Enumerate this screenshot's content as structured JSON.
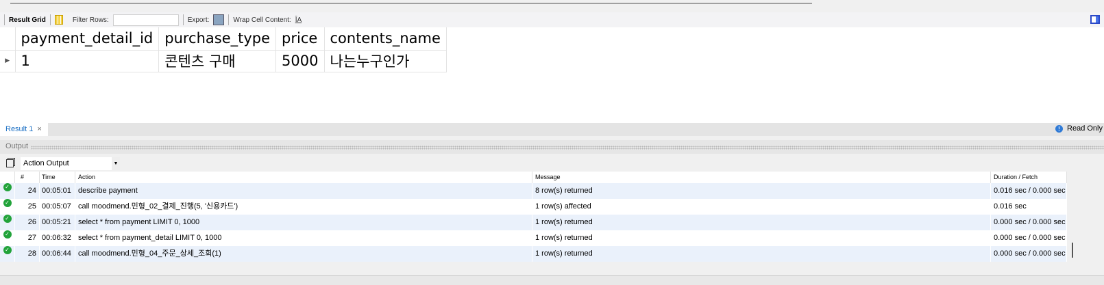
{
  "toolbar": {
    "result_grid": "Result Grid",
    "filter_rows": "Filter Rows:",
    "filter_value": "",
    "export": "Export:",
    "wrap": "Wrap Cell Content:",
    "wrap_icon": "̲↕A"
  },
  "grid": {
    "columns": [
      "payment_detail_id",
      "purchase_type",
      "price",
      "contents_name"
    ],
    "rows": [
      [
        "1",
        "콘텐츠 구매",
        "5000",
        "나는누구인가"
      ]
    ]
  },
  "tabs": {
    "result1": "Result 1",
    "close": "×",
    "read_only": "Read Only"
  },
  "output": {
    "title": "Output",
    "selector": "Action Output",
    "columns": [
      "#",
      "Time",
      "Action",
      "Message",
      "Duration / Fetch"
    ],
    "rows": [
      [
        "24",
        "00:05:01",
        "describe payment",
        "8 row(s) returned",
        "0.016 sec / 0.000 sec"
      ],
      [
        "25",
        "00:05:07",
        "call moodmend.민형_02_결제_진행(5, '신용카드')",
        "1 row(s) affected",
        "0.016 sec"
      ],
      [
        "26",
        "00:05:21",
        "select * from payment LIMIT 0, 1000",
        "1 row(s) returned",
        "0.000 sec / 0.000 sec"
      ],
      [
        "27",
        "00:06:32",
        "select * from payment_detail LIMIT 0, 1000",
        "1 row(s) returned",
        "0.000 sec / 0.000 sec"
      ],
      [
        "28",
        "00:06:44",
        "call moodmend.민형_04_주문_상세_조회(1)",
        "1 row(s) returned",
        "0.000 sec / 0.000 sec"
      ]
    ]
  },
  "colors": {
    "success": "#22a33a",
    "tab_active": "#1a6fc4",
    "row_alt": "#eaf1fb"
  }
}
